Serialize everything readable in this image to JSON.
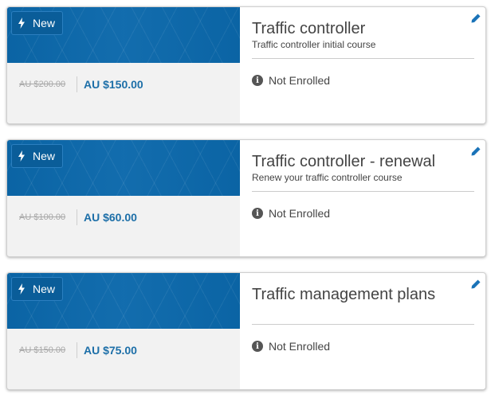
{
  "courses": [
    {
      "badge": "New",
      "old_price": "AU $200.00",
      "new_price": "AU $150.00",
      "title": "Traffic controller",
      "subtitle": "Traffic controller initial course",
      "status": "Not Enrolled"
    },
    {
      "badge": "New",
      "old_price": "AU $100.00",
      "new_price": "AU $60.00",
      "title": "Traffic controller - renewal",
      "subtitle": "Renew your traffic controller course",
      "status": "Not Enrolled"
    },
    {
      "badge": "New",
      "old_price": "AU $150.00",
      "new_price": "AU $75.00",
      "title": "Traffic management plans",
      "subtitle": "",
      "status": "Not Enrolled"
    }
  ],
  "colors": {
    "banner": "#0b68ab",
    "price_accent": "#1d6fa8",
    "edit_icon": "#1a73b8"
  },
  "icons": {
    "badge": "bolt-icon",
    "status": "info-icon",
    "edit": "pencil-icon"
  },
  "info_glyph": "i"
}
